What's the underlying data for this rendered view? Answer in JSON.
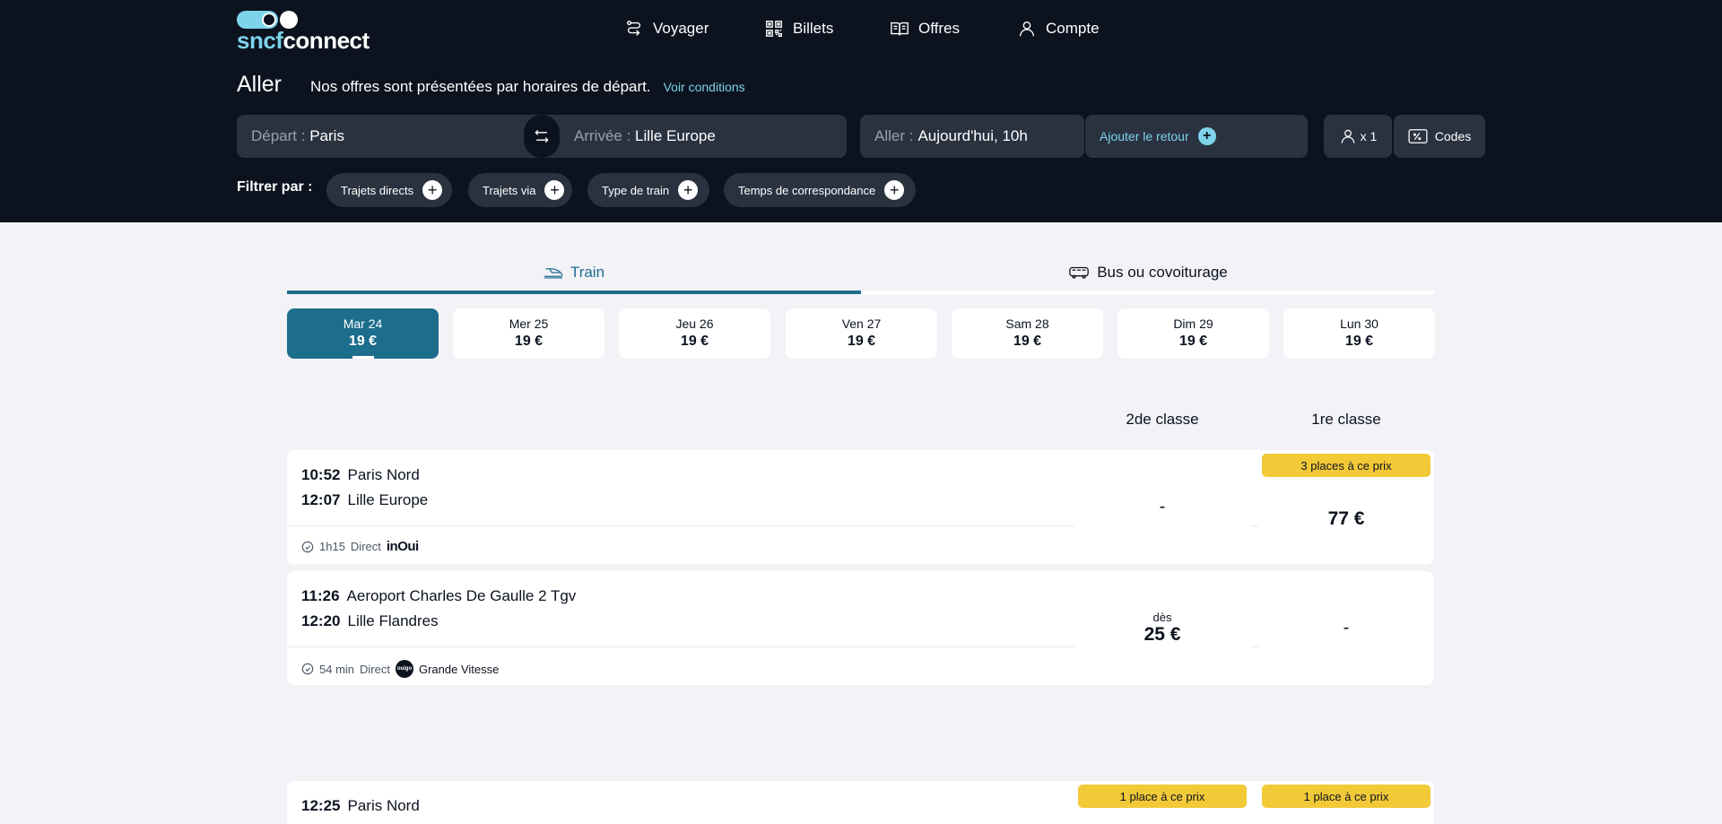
{
  "brand": {
    "part1": "sncf",
    "part2": "connect"
  },
  "nav": [
    {
      "label": "Voyager",
      "icon": "route-icon"
    },
    {
      "label": "Billets",
      "icon": "qr-code-icon"
    },
    {
      "label": "Offres",
      "icon": "book-icon"
    },
    {
      "label": "Compte",
      "icon": "user-icon"
    }
  ],
  "direction": {
    "title": "Aller",
    "description": "Nos offres sont présentées par horaires de départ.",
    "conditions_link": "Voir conditions"
  },
  "search": {
    "depart_label": "Départ :",
    "depart_value": "Paris",
    "arrivee_label": "Arrivée :",
    "arrivee_value": "Lille Europe",
    "aller_label": "Aller :",
    "aller_value": "Aujourd'hui, 10h",
    "retour_label": "Ajouter le retour",
    "passengers": "x 1",
    "codes": "Codes"
  },
  "filters": {
    "label": "Filtrer par :",
    "chips": [
      "Trajets directs",
      "Trajets via",
      "Type de train",
      "Temps de correspondance"
    ]
  },
  "modes": {
    "train": "Train",
    "bus": "Bus ou covoiturage"
  },
  "dates": [
    {
      "day": "Mar 24",
      "price": "19 €"
    },
    {
      "day": "Mer 25",
      "price": "19 €"
    },
    {
      "day": "Jeu 26",
      "price": "19 €"
    },
    {
      "day": "Ven 27",
      "price": "19 €"
    },
    {
      "day": "Sam 28",
      "price": "19 €"
    },
    {
      "day": "Dim 29",
      "price": "19 €"
    },
    {
      "day": "Lun 30",
      "price": "19 €"
    }
  ],
  "class_headers": {
    "second": "2de classe",
    "first": "1re classe"
  },
  "journeys": [
    {
      "dep_time": "10:52",
      "dep_station": "Paris Nord",
      "arr_time": "12:07",
      "arr_station": "Lille Europe",
      "duration": "1h15",
      "type": "Direct",
      "operator": "inOui",
      "wifi": true,
      "second": {
        "price": "-",
        "badge": ""
      },
      "first": {
        "price": "77 €",
        "badge": "3 places à ce prix"
      }
    },
    {
      "dep_time": "11:26",
      "dep_station": "Aeroport Charles De Gaulle 2 Tgv",
      "arr_time": "12:20",
      "arr_station": "Lille Flandres",
      "duration": "54 min",
      "type": "Direct",
      "operator": "Grande Vitesse",
      "operator_logo": "ouigo",
      "second": {
        "prefix": "dès",
        "price": "25 €"
      },
      "first": {
        "price": "-"
      }
    },
    {
      "dep_time": "12:25",
      "dep_station": "Paris Nord",
      "second": {
        "badge": "1 place à ce prix"
      },
      "first": {
        "badge": "1 place à ce prix"
      }
    }
  ]
}
